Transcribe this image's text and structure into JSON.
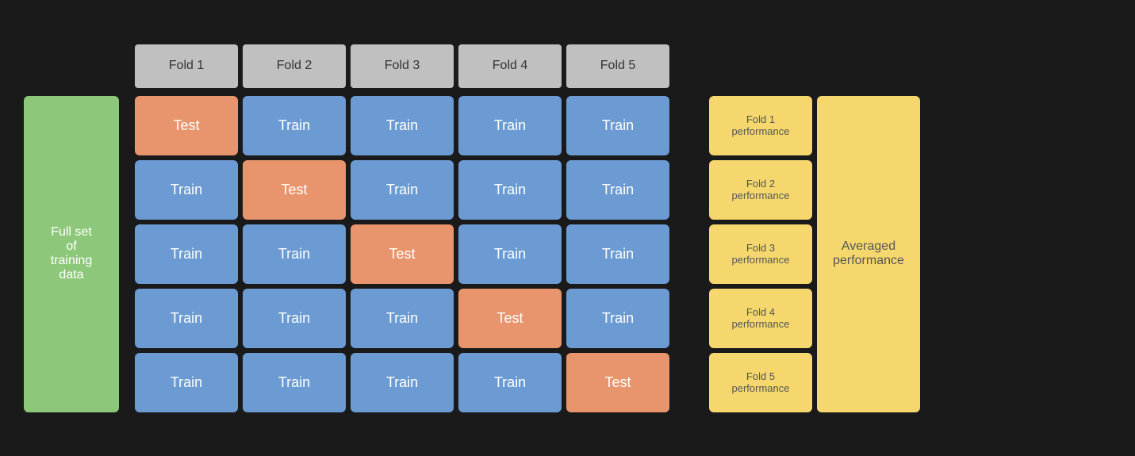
{
  "folds": {
    "headers": [
      "Fold 1",
      "Fold 2",
      "Fold 3",
      "Fold 4",
      "Fold 5"
    ]
  },
  "full_set_label": "Full set\nof\ntraining\ndata",
  "grid": [
    [
      "test",
      "train",
      "train",
      "train",
      "train"
    ],
    [
      "train",
      "test",
      "train",
      "train",
      "train"
    ],
    [
      "train",
      "train",
      "test",
      "train",
      "train"
    ],
    [
      "train",
      "train",
      "train",
      "test",
      "train"
    ],
    [
      "train",
      "train",
      "train",
      "train",
      "test"
    ]
  ],
  "cell_labels": {
    "train": "Train",
    "test": "Test"
  },
  "performance": {
    "items": [
      "Fold 1\nperformance",
      "Fold 2\nperformance",
      "Fold 3\nperformance",
      "Fold 4\nperformance",
      "Fold 5\nperformance"
    ],
    "averaged": "Averaged\nperformance"
  }
}
